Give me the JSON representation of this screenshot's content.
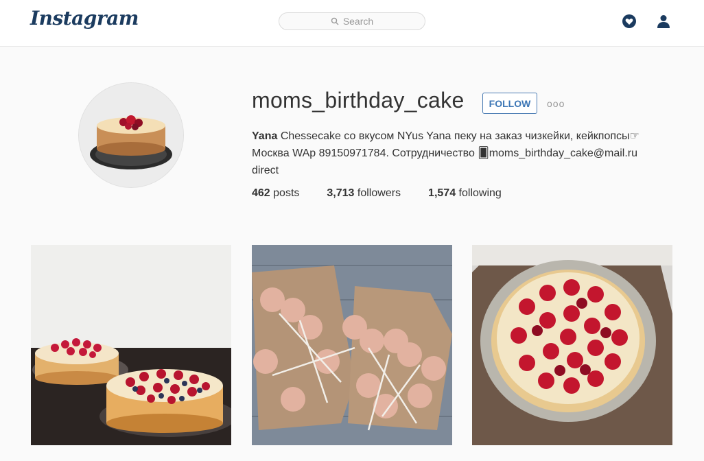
{
  "header": {
    "logo_text": "Instagram",
    "search_placeholder": "Search"
  },
  "profile": {
    "username": "moms_birthday_cake",
    "follow_label": "FOLLOW",
    "more_label": "ooo",
    "bio_name": "Yana",
    "bio_line1": "Chessecake со вкусом NYus Yana пеку на заказ чизкейки, кейкпопсы☞",
    "bio_line2": "Москва WAp 89150971784. Сотрудничество 🂠moms_birthday_cake@mail.ru",
    "bio_line3": "direct",
    "stats": {
      "posts_count": "462",
      "posts_label": "posts",
      "followers_count": "3,713",
      "followers_label": "followers",
      "following_count": "1,574",
      "following_label": "following"
    }
  },
  "colors": {
    "brand": "#1b3b5f",
    "follow_blue": "#3c76b5",
    "background": "#fafafa"
  },
  "icons": {
    "search": "search-icon",
    "activity": "heart-icon",
    "profile": "profile-icon"
  }
}
